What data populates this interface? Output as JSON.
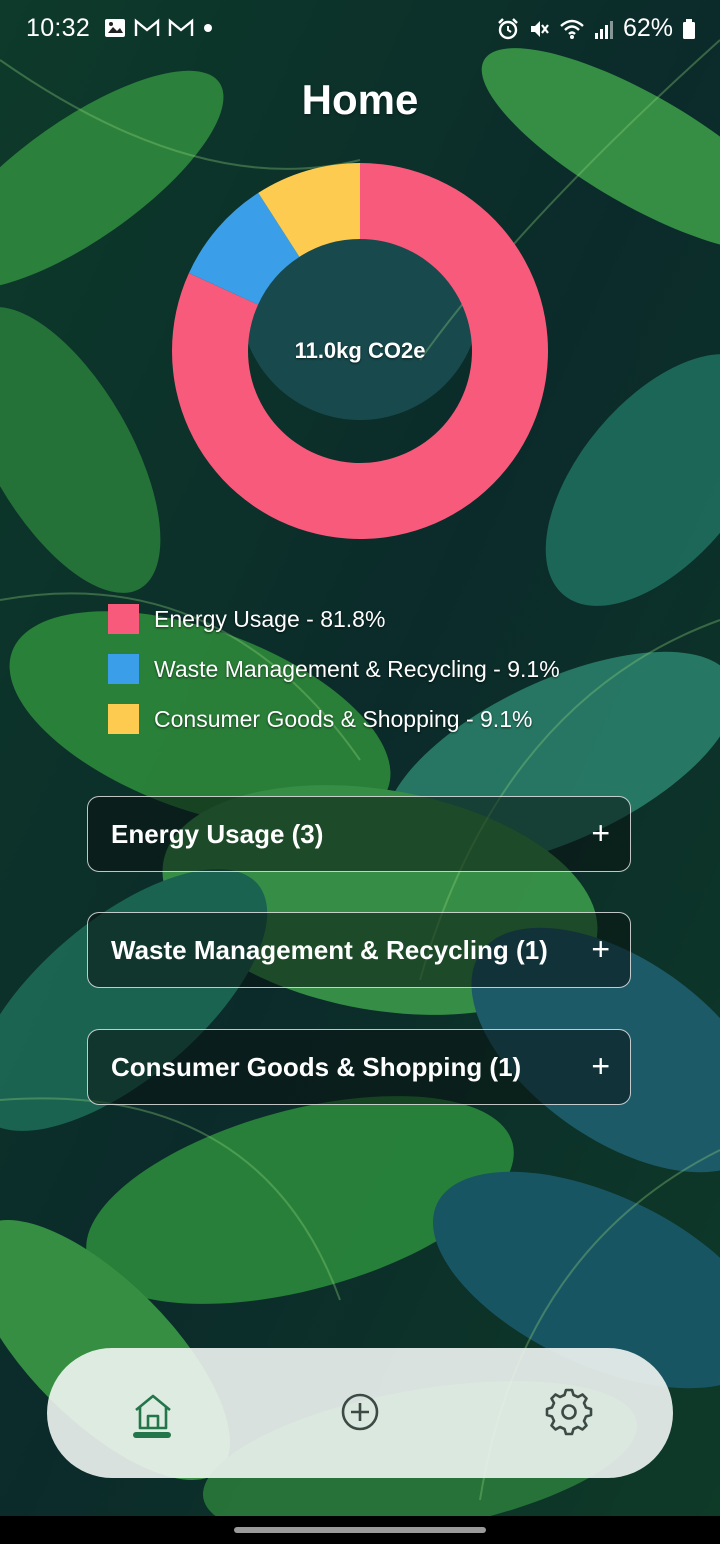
{
  "status_bar": {
    "time": "10:32",
    "battery": "62%"
  },
  "header": {
    "title": "Home"
  },
  "chart_data": {
    "type": "pie",
    "center_label": "11.0kg CO2e",
    "categories": [
      "Energy Usage",
      "Waste Management & Recycling",
      "Consumer Goods & Shopping"
    ],
    "values": [
      81.8,
      9.1,
      9.1
    ],
    "colors": [
      "#f75a7b",
      "#3b9ee8",
      "#fccb50"
    ],
    "legend": [
      {
        "label": "Energy Usage - 81.8%",
        "color": "#f75a7b"
      },
      {
        "label": "Waste Management & Recycling - 9.1%",
        "color": "#3b9ee8"
      },
      {
        "label": "Consumer Goods & Shopping - 9.1%",
        "color": "#fccb50"
      }
    ]
  },
  "categories": [
    {
      "label": "Energy Usage (3)",
      "action": "+"
    },
    {
      "label": "Waste Management & Recycling (1)",
      "action": "+"
    },
    {
      "label": "Consumer Goods & Shopping (1)",
      "action": "+"
    }
  ],
  "bottom_nav": {
    "items": [
      {
        "icon": "home-icon",
        "active": true
      },
      {
        "icon": "add-circle-icon",
        "active": false
      },
      {
        "icon": "gear-icon",
        "active": false
      }
    ],
    "accent": "#23754a",
    "icon_color": "#3b4a44"
  }
}
